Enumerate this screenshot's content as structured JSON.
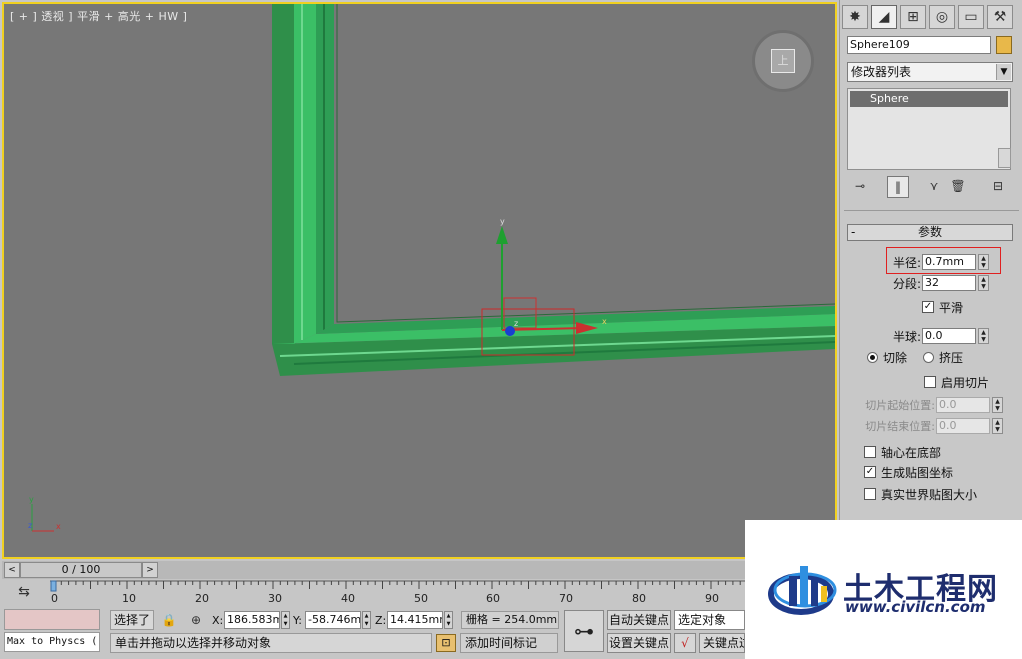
{
  "viewport": {
    "label": "[ + ] 透视 ] 平滑 + 高光 + HW ]",
    "viewcube_face": "上",
    "gizmo_axis_labels": {
      "x": "x",
      "y": "y",
      "z": "z"
    },
    "axis_tripod": {
      "x": "x",
      "y": "y",
      "z": "z"
    }
  },
  "command_panel": {
    "tabs": [
      {
        "icon": "create-icon",
        "glyph": "✸"
      },
      {
        "icon": "modify-icon",
        "glyph": "◢"
      },
      {
        "icon": "hierarchy-icon",
        "glyph": "⊞"
      },
      {
        "icon": "motion-icon",
        "glyph": "◎"
      },
      {
        "icon": "display-icon",
        "glyph": "▭"
      },
      {
        "icon": "utilities-icon",
        "glyph": "⚒"
      }
    ],
    "object_name": "Sphere109",
    "object_color": "#e8b84a",
    "modifier_list": "修改器列表",
    "stack_items": [
      "Sphere"
    ],
    "params": {
      "rollout_title": "参数",
      "radius_label": "半径:",
      "radius_value": "0.7mm",
      "segments_label": "分段:",
      "segments_value": "32",
      "smooth_label": "平滑",
      "smooth_checked": true,
      "hemisphere_label": "半球:",
      "hemisphere_value": "0.0",
      "chop_label": "切除",
      "squash_label": "挤压",
      "enable_slice_label": "启用切片",
      "slice_from_label": "切片起始位置:",
      "slice_from_value": "0.0",
      "slice_to_label": "切片结束位置:",
      "slice_to_value": "0.0",
      "base_to_pivot_label": "轴心在底部",
      "gen_mapping_label": "生成贴图坐标",
      "gen_mapping_checked": true,
      "real_world_label": "真实世界贴图大小"
    }
  },
  "time_slider": {
    "left": "<",
    "label": "0 / 100",
    "right": ">"
  },
  "trackbar": {
    "ticks": [
      "0",
      "10",
      "20",
      "30",
      "40",
      "50",
      "60",
      "70",
      "80",
      "90"
    ]
  },
  "status": {
    "maxscript_text": "Max to Physcs (",
    "selection": "选择了",
    "x_label": "X:",
    "x_value": "186.583mm",
    "y_label": "Y:",
    "y_value": "-58.746mm",
    "z_label": "Z:",
    "z_value": "14.415mm",
    "grid": "栅格 = 254.0mm",
    "prompt": "单击并拖动以选择并移动对象",
    "add_time_tag": "添加时间标记",
    "auto_key": "自动关键点",
    "set_key": "设置关键点",
    "selected_object": "选定对象",
    "key_filters": "关键点过"
  },
  "watermark": {
    "title": "土木工程网",
    "url": "www.civilcn.com"
  }
}
